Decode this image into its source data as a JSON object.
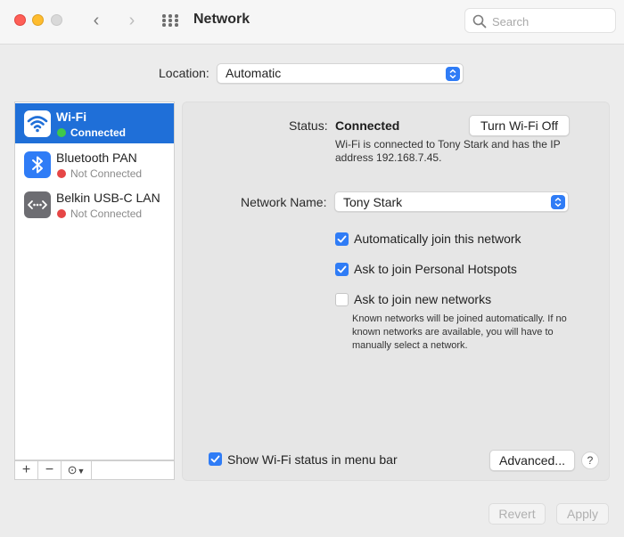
{
  "window": {
    "title": "Network"
  },
  "search": {
    "placeholder": "Search"
  },
  "location": {
    "label": "Location:",
    "value": "Automatic"
  },
  "services": [
    {
      "name": "Wi-Fi",
      "status": "Connected",
      "status_color": "#3fc84b",
      "icon": "wifi-icon",
      "selected": true
    },
    {
      "name": "Bluetooth PAN",
      "status": "Not Connected",
      "status_color": "#e64646",
      "icon": "bluetooth-icon",
      "selected": false
    },
    {
      "name": "Belkin USB-C LAN",
      "status": "Not Connected",
      "status_color": "#e64646",
      "icon": "ethernet-icon",
      "selected": false
    }
  ],
  "sidebar_toolbar": {
    "add": "+",
    "remove": "−",
    "more": "⊙"
  },
  "detail": {
    "status_label": "Status:",
    "status_value": "Connected",
    "turn_off_button": "Turn Wi-Fi Off",
    "status_description": "Wi-Fi is connected to Tony Stark and has the IP address 192.168.7.45.",
    "network_name_label": "Network Name:",
    "network_name_value": "Tony Stark",
    "checkboxes": [
      {
        "label": "Automatically join this network",
        "checked": true
      },
      {
        "label": "Ask to join Personal Hotspots",
        "checked": true
      },
      {
        "label": "Ask to join new networks",
        "checked": false
      }
    ],
    "join_description": "Known networks will be joined automatically. If no known networks are available, you will have to manually select a network.",
    "show_status_label": "Show Wi-Fi status in menu bar",
    "show_status_checked": true,
    "advanced_button": "Advanced...",
    "help_button": "?"
  },
  "footer": {
    "revert_button": "Revert",
    "apply_button": "Apply"
  },
  "colors": {
    "accent": "#2f7cf6",
    "selection": "#1f6fd8"
  }
}
